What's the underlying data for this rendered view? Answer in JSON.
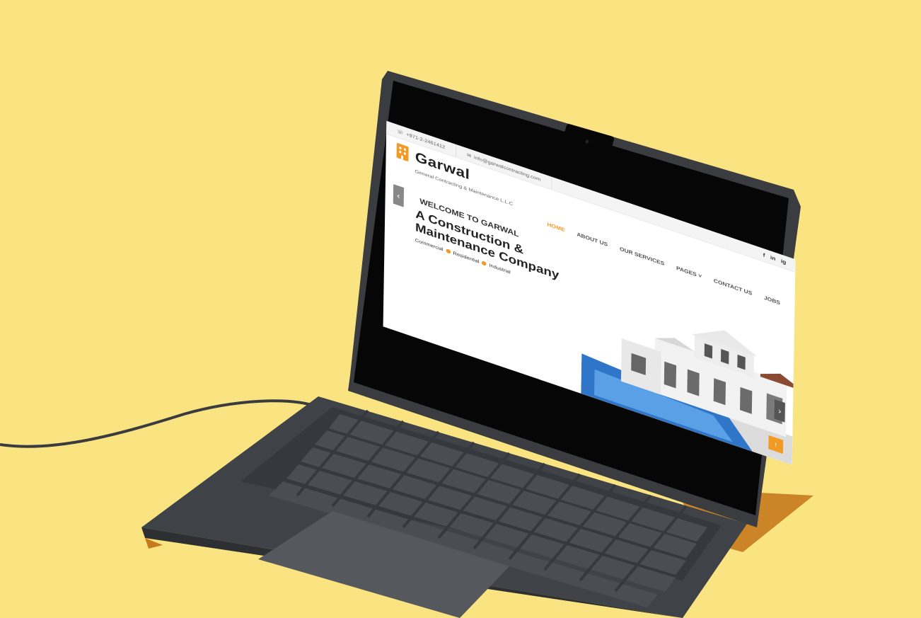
{
  "colors": {
    "background": "#fae482",
    "accent": "#f29a24",
    "laptop": "#3f4246"
  },
  "topbar": {
    "phone_icon": "phone-icon",
    "phone": "+971-2-2461412",
    "email_icon": "mail-icon",
    "email": "info@garwalcontracting.com",
    "socials": [
      "f",
      "in",
      "ig"
    ]
  },
  "brand": {
    "name": "Garwal",
    "tagline": "General Contracting & Maintenance L.L.C"
  },
  "nav": {
    "items": [
      "HOME",
      "ABOUT US",
      "OUR SERVICES",
      "PAGES",
      "CONTACT US",
      "JOBS"
    ],
    "active": "HOME"
  },
  "hero": {
    "welcome": "WELCOME TO GARWAL",
    "headline_line1": "A Construction &",
    "headline_line2": "Maintenance Company",
    "tags": [
      "Commercial",
      "Residential",
      "Industrial"
    ],
    "prev_icon": "chevron-left-icon",
    "next_icon": "chevron-right-icon",
    "scroll_top_icon": "arrow-up-icon"
  }
}
